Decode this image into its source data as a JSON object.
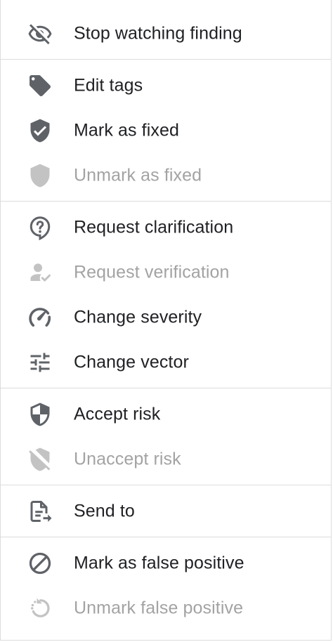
{
  "menu": {
    "items": {
      "stop_watching": {
        "label": "Stop watching finding",
        "icon": "eye-off-icon",
        "enabled": true
      },
      "edit_tags": {
        "label": "Edit tags",
        "icon": "tag-icon",
        "enabled": true
      },
      "mark_fixed": {
        "label": "Mark as fixed",
        "icon": "shield-check-icon",
        "enabled": true
      },
      "unmark_fixed": {
        "label": "Unmark as fixed",
        "icon": "shield-icon",
        "enabled": false
      },
      "request_clarification": {
        "label": "Request clarification",
        "icon": "question-bubble-icon",
        "enabled": true
      },
      "request_verification": {
        "label": "Request verification",
        "icon": "user-check-icon",
        "enabled": false
      },
      "change_severity": {
        "label": "Change severity",
        "icon": "speedometer-icon",
        "enabled": true
      },
      "change_vector": {
        "label": "Change vector",
        "icon": "tune-icon",
        "enabled": true
      },
      "accept_risk": {
        "label": "Accept risk",
        "icon": "shield-half-icon",
        "enabled": true
      },
      "unaccept_risk": {
        "label": "Unaccept risk",
        "icon": "shield-off-icon",
        "enabled": false
      },
      "send_to": {
        "label": "Send to",
        "icon": "document-send-icon",
        "enabled": true
      },
      "mark_false_positive": {
        "label": "Mark as false positive",
        "icon": "block-icon",
        "enabled": true
      },
      "unmark_false_positive": {
        "label": "Unmark false positive",
        "icon": "restore-dotted-icon",
        "enabled": false
      }
    }
  },
  "colors": {
    "icon_enabled": "#5f6368",
    "icon_disabled": "#c3c3c3",
    "text_enabled": "#202124",
    "text_disabled": "#a3a3a3",
    "divider": "#dcdcdc"
  }
}
